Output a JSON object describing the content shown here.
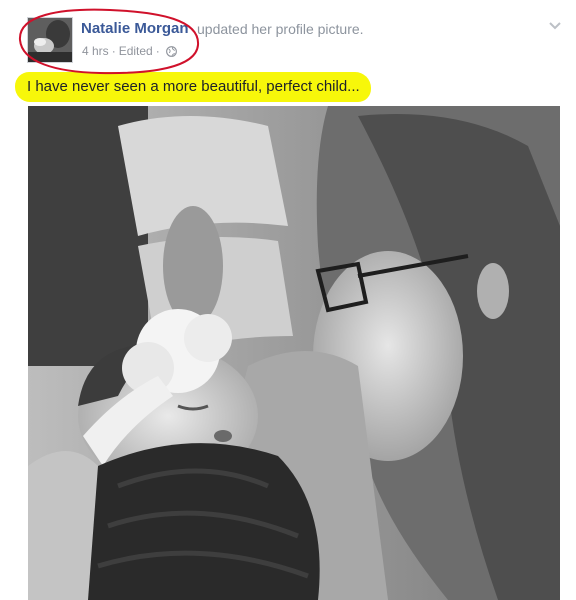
{
  "post": {
    "author_name": "Natalie Morgan",
    "action_text": "updated her profile picture.",
    "time_text": "4 hrs",
    "edited_text": "Edited",
    "separator": "·",
    "privacy_icon": "globe-icon",
    "menu_icon": "chevron-down-icon",
    "caption": "I have never seen a more beautiful, perfect child..."
  },
  "colors": {
    "author_link": "#3b5998",
    "highlight": "#f7f70a",
    "annotation_circle": "#d0112b"
  }
}
